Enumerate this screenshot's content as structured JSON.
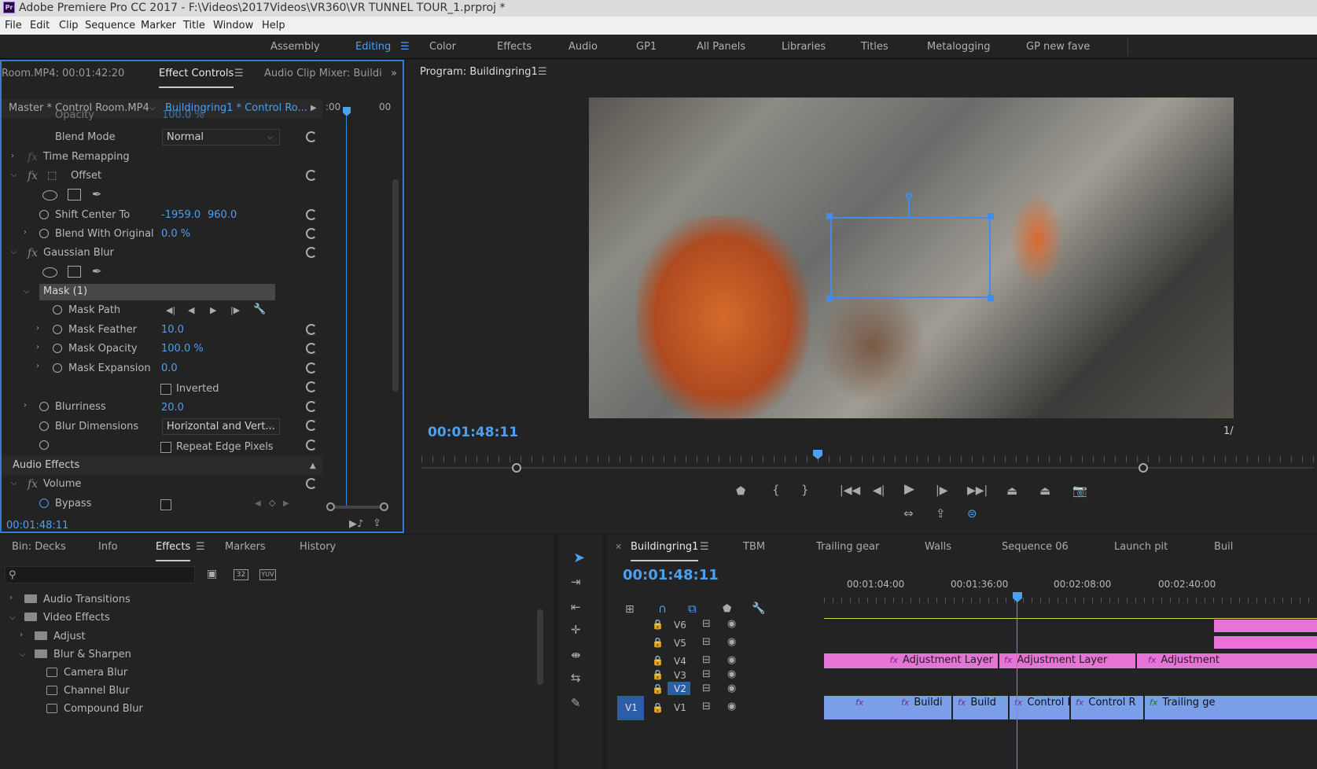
{
  "title": "Adobe Premiere Pro CC 2017 - F:\\Videos\\2017Videos\\VR360\\VR TUNNEL TOUR_1.prproj *",
  "menu": [
    "File",
    "Edit",
    "Clip",
    "Sequence",
    "Marker",
    "Title",
    "Window",
    "Help"
  ],
  "workspaces": [
    "Assembly",
    "Editing",
    "Color",
    "Effects",
    "Audio",
    "GP1",
    "All Panels",
    "Libraries",
    "Titles",
    "Metalogging",
    "GP new fave"
  ],
  "effect_controls": {
    "source_tab": "Room.MP4: 00:01:42:20",
    "tab_effect_controls": "Effect Controls",
    "tab_audio_mixer": "Audio Clip Mixer: Buildi",
    "master_label": "Master * Control Room.MP4",
    "sequence_label": "Buildingring1 * Control Ro...",
    "ruler_left": ":00",
    "ruler_right": "00",
    "opacity_label": "Opacity",
    "opacity_value": "100.0 %",
    "blend_mode_label": "Blend Mode",
    "blend_mode_value": "Normal",
    "time_remapping": "Time Remapping",
    "offset": "Offset",
    "shift_center_label": "Shift Center To",
    "shift_center_x": "-1959.0",
    "shift_center_y": "960.0",
    "blend_original_label": "Blend With Original",
    "blend_original_value": "0.0 %",
    "gaussian_blur": "Gaussian Blur",
    "mask": "Mask (1)",
    "mask_path": "Mask Path",
    "mask_feather_label": "Mask Feather",
    "mask_feather_value": "10.0",
    "mask_opacity_label": "Mask Opacity",
    "mask_opacity_value": "100.0 %",
    "mask_expansion_label": "Mask Expansion",
    "mask_expansion_value": "0.0",
    "inverted": "Inverted",
    "blurriness_label": "Blurriness",
    "blurriness_value": "20.0",
    "blur_dimensions_label": "Blur Dimensions",
    "blur_dimensions_value": "Horizontal and Vert...",
    "repeat_edge": "Repeat Edge Pixels",
    "audio_effects": "Audio Effects",
    "volume": "Volume",
    "bypass": "Bypass",
    "timecode": "00:01:48:11"
  },
  "program": {
    "title": "Program: Buildingring1",
    "timecode": "00:01:48:11",
    "right_fraction": "1/"
  },
  "project": {
    "tabs": [
      "Bin: Decks",
      "Info",
      "Effects",
      "Markers",
      "History"
    ],
    "search_placeholder": "",
    "tree": [
      {
        "label": "Audio Transitions",
        "kind": "folder"
      },
      {
        "label": "Video Effects",
        "kind": "folder"
      },
      {
        "label": "Adjust",
        "kind": "folder"
      },
      {
        "label": "Blur & Sharpen",
        "kind": "folder"
      },
      {
        "label": "Camera Blur",
        "kind": "effect"
      },
      {
        "label": "Channel Blur",
        "kind": "effect"
      },
      {
        "label": "Compound Blur",
        "kind": "effect"
      }
    ],
    "filter_labels": [
      "32",
      "YUV"
    ]
  },
  "timeline": {
    "tabs": [
      "Buildingring1",
      "TBM",
      "Trailing gear",
      "Walls",
      "Sequence 06",
      "Launch pit",
      "Buil"
    ],
    "timecode": "00:01:48:11",
    "ruler": [
      "00:01:04:00",
      "00:01:36:00",
      "00:02:08:00",
      "00:02:40:00"
    ],
    "tracks": [
      "V6",
      "V5",
      "V4",
      "V3",
      "V2",
      "V1"
    ],
    "v1_source": "V1",
    "v4_clips": [
      "Adjustment Layer",
      "Adjustment Layer",
      "Adjustment"
    ],
    "v1_clips": [
      "Buildi",
      "Build",
      "Control I",
      "Control R",
      "Trailing ge"
    ]
  },
  "colors": {
    "accent": "#4d9ff0",
    "adjustment_clip": "#e673d6",
    "video_clip": "#7a9fe8",
    "panel_border": "#2f7fd8"
  }
}
